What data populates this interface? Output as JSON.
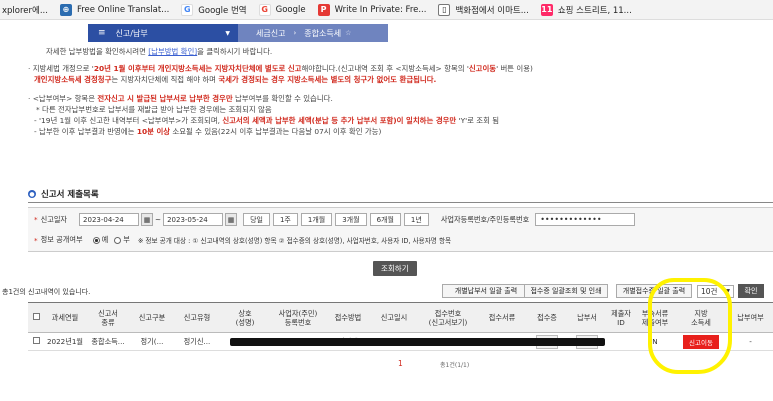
{
  "bookmarks": [
    {
      "label": "xplorer에...",
      "icon": "page-icon",
      "color": "#ffffff"
    },
    {
      "label": "Free Online Translat...",
      "icon": "translate-icon",
      "color": "#2b6cb0"
    },
    {
      "label": "Google 번역",
      "icon": "google-icon",
      "color": "#4285f4"
    },
    {
      "label": "Google",
      "icon": "google-icon",
      "color": "#4285f4"
    },
    {
      "label": "Write In Private: Fre...",
      "icon": "p-icon",
      "color": "#e53935"
    },
    {
      "label": "백화점에서 이마트...",
      "icon": "doc-icon",
      "color": "#ffffff"
    },
    {
      "label": "쇼핑 스트리트, 11...",
      "icon": "shop-icon",
      "color": "#ff2a68"
    }
  ],
  "nav": {
    "main": "신고/납부",
    "sub1": "세금신고",
    "sub2": "종합소득세"
  },
  "notice": {
    "l1a": "자세한 납부방법을 확인하시려면 ",
    "l1link": "[납부방법 확인]",
    "l1b": "을 클릭하시기 바랍니다.",
    "l2a": "· 지방세법 개정으로 '",
    "l2b": "20년 1월 이후부터 개인지방소득세는 지방자치단체에 별도로 신고",
    "l2c": "해야합니다.(신고내역 조회 후 <지방소득세> 항목의 '",
    "l2d": "신고이동",
    "l2e": "' 버튼 이용)",
    "l3a": "개인지방소득세 경정청구",
    "l3b": "는 지방자치단체에 직접 해야 하며 ",
    "l3c": "국세가 경정되는 경우 지방소득세는 별도의 청구가 없어도 환급됩니다.",
    "l4a": "· <납부여부> 항목은 ",
    "l4b": "전자신고 시 발급된 납부서로 납부한 경우만",
    "l4c": " 납부여부를 확인할 수 있습니다.",
    "l5": "* 다른 전자납부번호로 납부서를 재발급 받아 납부한 경우에는 조회되지 않음",
    "l6a": "- '19년 1월 이후 신고한 내역부터 <납부여부>가 조회되며, ",
    "l6b": "신고서의 세액과 납부한 세액(분납 등 추가 납부서 포함)이 일치하는 경우만",
    "l6c": " 'Y'로 조회 됨",
    "l7a": "- 납부한 이후 납부결과 반영에는 ",
    "l7b": "10분 이상",
    "l7c": " 소요될 수 있음(22시 이후 납부결과는 다음날 07시 이후 확인 가능)"
  },
  "section_title": "신고서 제출목록",
  "search": {
    "period_label": "신고일자",
    "date_from": "2023-04-24",
    "date_to": "2023-05-24",
    "tilde": "~",
    "periods": [
      "당일",
      "1주",
      "1개월",
      "3개월",
      "6개월",
      "1년"
    ],
    "biz_label": "사업자등록번호/주민등록번호",
    "biz_value": "•••••••••••••",
    "disclose_label": "정보 공개여부",
    "opt_yes": "예",
    "opt_no": "부",
    "disclose_note": "※ 정보 공개 대상 : ① 신고내역의 상호(성명) 항목 ② 접수증의 상호(성명), 사업자번호, 사용자 ID, 사용자명 항목"
  },
  "lookup_label": "조회하기",
  "result_count": "총1건의 신고내역이 있습니다.",
  "toolbar": {
    "b1": "개별납부서 일괄 출력",
    "b2": "접수증 일괄조회 및 인쇄",
    "b3": "개별접수증 일괄 출력",
    "page_size": "10건",
    "confirm": "확인"
  },
  "table": {
    "headers": [
      "과세연월",
      "신고서\n종류",
      "신고구분",
      "신고유형",
      "상호\n(성명)",
      "사업자(주민)\n등록번호",
      "접수방법",
      "신고일시",
      "접수번호\n(신고서보기)",
      "접수서류",
      "접수증",
      "납부서",
      "제출자\nID",
      "부속서류\n제출여부",
      "지방\n소득세",
      "납부여부"
    ],
    "row": [
      "2022년1월",
      "종합소득...",
      "정기(...",
      "정기신...",
      "",
      "",
      "인터넷",
      "2023-05-...",
      "",
      "",
      "보기",
      "보기",
      "",
      "N",
      "신고이동",
      "-"
    ]
  },
  "pager": {
    "page": "1",
    "count": "총1건(1/1)"
  },
  "colors": {
    "nav_main": "#2c4fa3",
    "nav_sub": "#6f84bf",
    "accent_red": "#e8201c",
    "highlight": "#fff200"
  }
}
